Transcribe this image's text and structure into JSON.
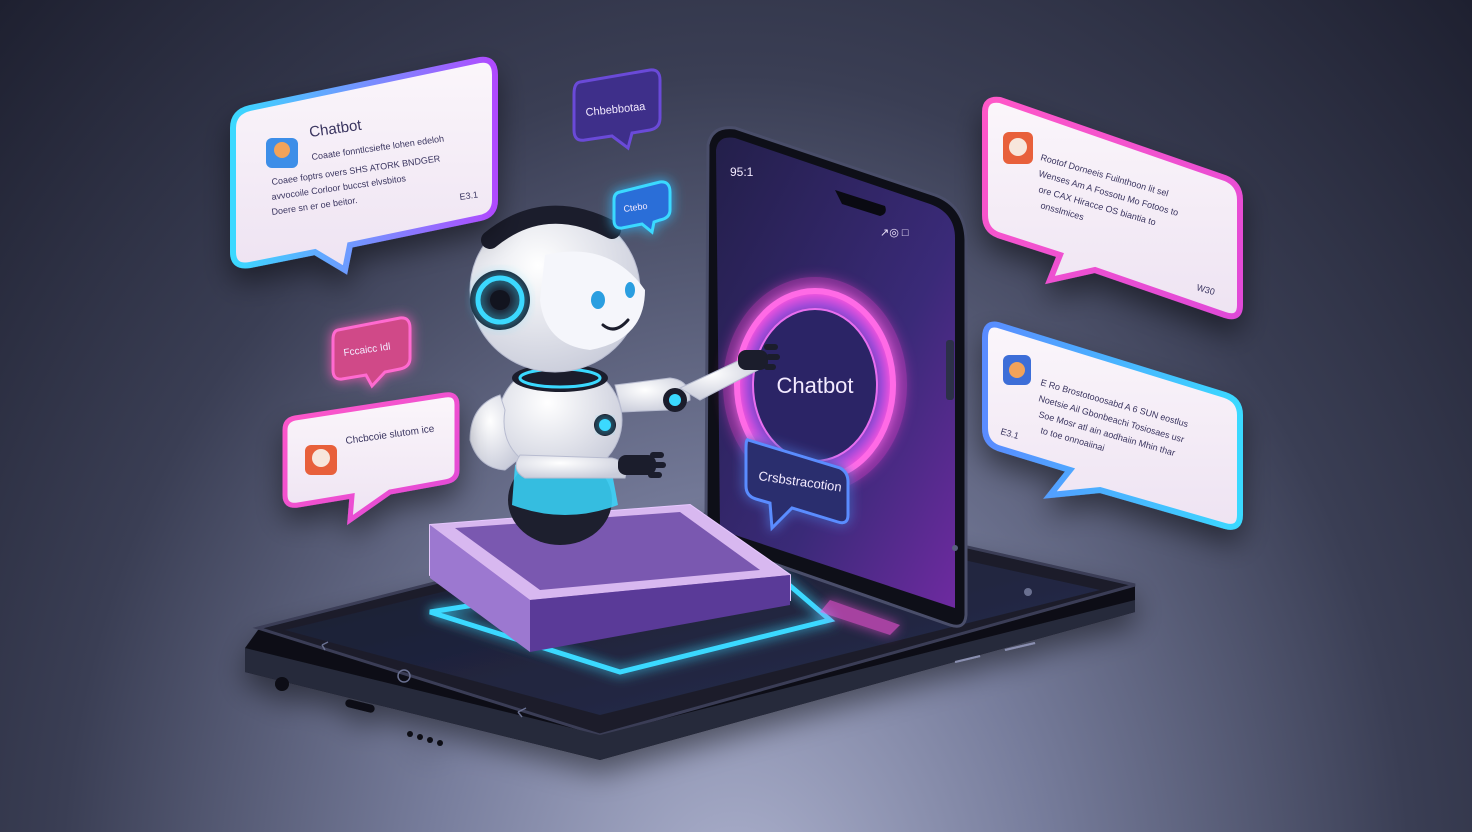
{
  "scene": {
    "colors": {
      "accent_pink": "#ff4fd0",
      "accent_cyan": "#3ad9ff",
      "accent_purple": "#6a4ad8",
      "phone_body": "#12141f",
      "bubble_fill": "#f6eef8"
    }
  },
  "bubbles": {
    "main_left": {
      "title": "Chatbot",
      "lines": [
        "Coaate fonntlcsiefte lohen edeloh",
        "Coaee foptrs overs SHS ATORK BNDGER",
        "avvocoile Corloor buccst elvsbitos",
        "Doere sn er oe beitor."
      ],
      "time": "E3.1"
    },
    "top_center": {
      "label": "Chbebbotaa"
    },
    "small_cyan": {
      "label": "Ctebo"
    },
    "small_pink": {
      "label": "Fccaicc Idl"
    },
    "left_lower": {
      "text": "Chcbcoie slutom ice"
    },
    "right_top": {
      "lines": [
        "Rootof Dorneeis Fuilnthoon lit sel",
        "Wenses Am A Fossotu Mo Fotoos to",
        "ore CAX Hiracce OS biantia to",
        "onsslmices"
      ],
      "time": "W30"
    },
    "right_lower": {
      "lines": [
        "E Ro Brostotooosabd A 6 SUN eostlus",
        "Noetsie Ail Gbonbeachi Tosiosaes usr",
        "Soe Mosr atl ain aodhaiin Mhin thar",
        "to toe onnoaiinai"
      ],
      "time": "E3.1"
    }
  },
  "phone": {
    "status_time": "95:1",
    "status_icons": "↗◎ □",
    "ring_label": "Chatbot",
    "screen_button": "Crsbstracotion"
  }
}
